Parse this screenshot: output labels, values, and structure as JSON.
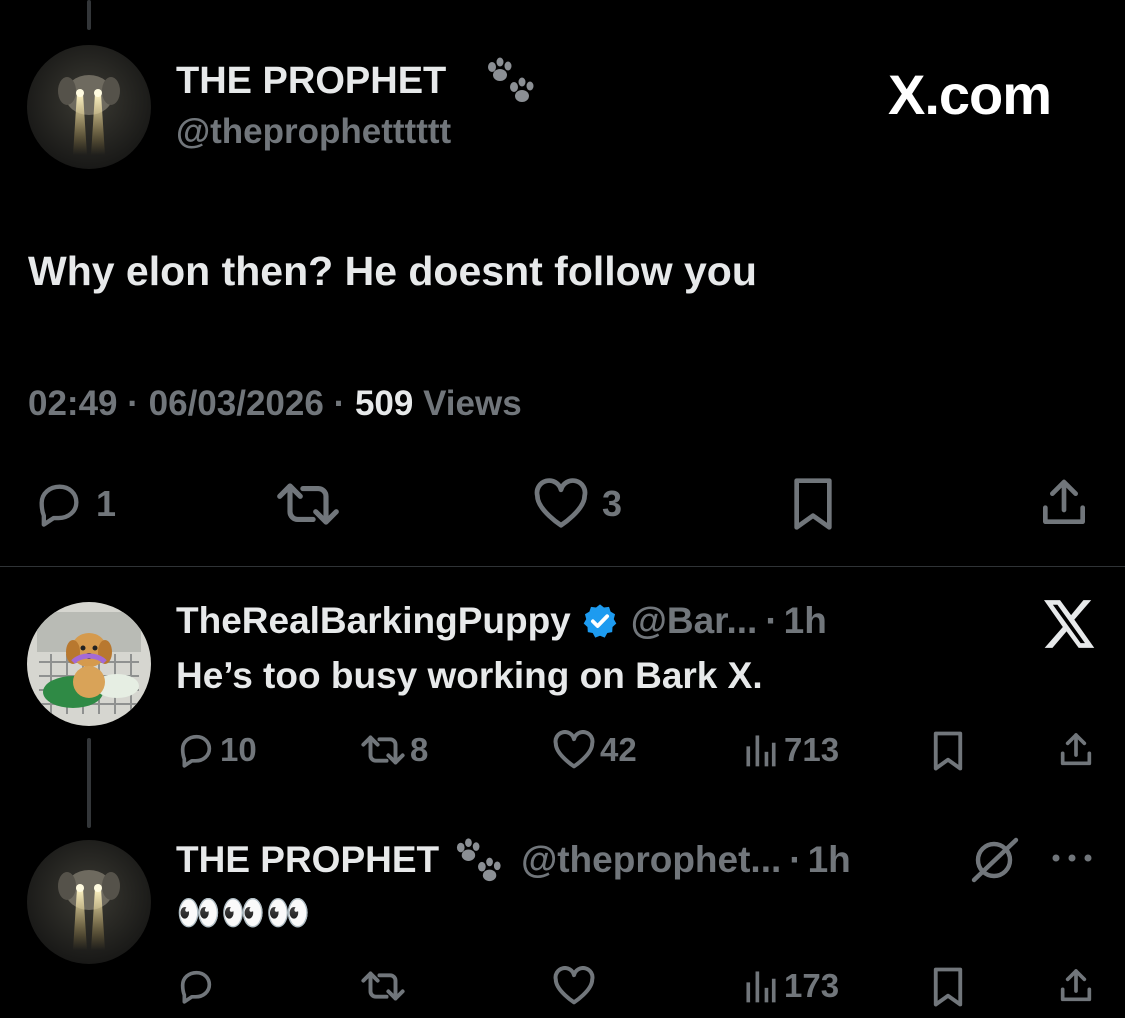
{
  "main_tweet": {
    "display_name": "THE PROPHET",
    "handle": "@theprophetttttt",
    "text": "Why elon then? He doesnt follow you",
    "time": "02:49",
    "sep1": "·",
    "date": "06/03/2026",
    "sep2": "·",
    "views_count": "509",
    "views_label": "Views",
    "stats": {
      "replies": "1",
      "likes": "3"
    },
    "brand": "X.com"
  },
  "reply": {
    "display_name": "TheRealBarkingPuppy",
    "handle": "@Bar...",
    "sep": "·",
    "age": "1h",
    "text": "He’s too busy working on Bark X.",
    "stats": {
      "replies": "10",
      "reposts": "8",
      "likes": "42",
      "views": "713"
    }
  },
  "reply2": {
    "display_name": "THE PROPHET",
    "handle": "@theprophet...",
    "sep": "·",
    "age": "1h",
    "text": "👀👀👀",
    "stats": {
      "views": "173"
    }
  },
  "colors": {
    "background": "#000000",
    "text": "#e7e9ea",
    "muted": "#71767b",
    "verified": "#1d9bf0"
  }
}
